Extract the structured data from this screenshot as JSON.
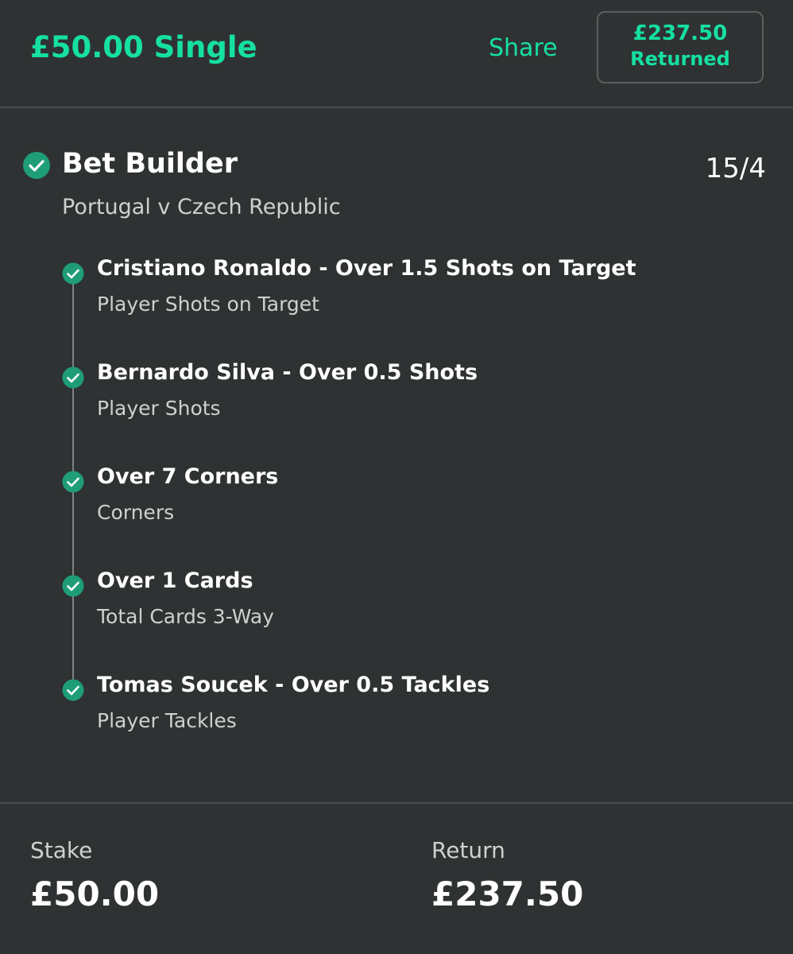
{
  "header": {
    "title": "£50.00 Single",
    "share_label": "Share",
    "returned_amount": "£237.50",
    "returned_label": "Returned"
  },
  "bet_builder": {
    "title": "Bet Builder",
    "odds": "15/4",
    "match": "Portugal v Czech Republic",
    "status_icon": "check-circle-icon",
    "legs": [
      {
        "selection": "Cristiano Ronaldo - Over 1.5 Shots on Target",
        "market": "Player Shots on Target"
      },
      {
        "selection": "Bernardo Silva - Over 0.5 Shots",
        "market": "Player Shots"
      },
      {
        "selection": "Over 7 Corners",
        "market": "Corners"
      },
      {
        "selection": "Over 1 Cards",
        "market": "Total Cards 3-Way"
      },
      {
        "selection": "Tomas Soucek - Over 0.5 Tackles",
        "market": "Player Tackles"
      }
    ]
  },
  "footer": {
    "stake_label": "Stake",
    "stake_value": "£50.00",
    "return_label": "Return",
    "return_value": "£237.50"
  },
  "colors": {
    "accent": "#15e0a1",
    "background": "#2f3232",
    "check": "#1f9d78"
  }
}
